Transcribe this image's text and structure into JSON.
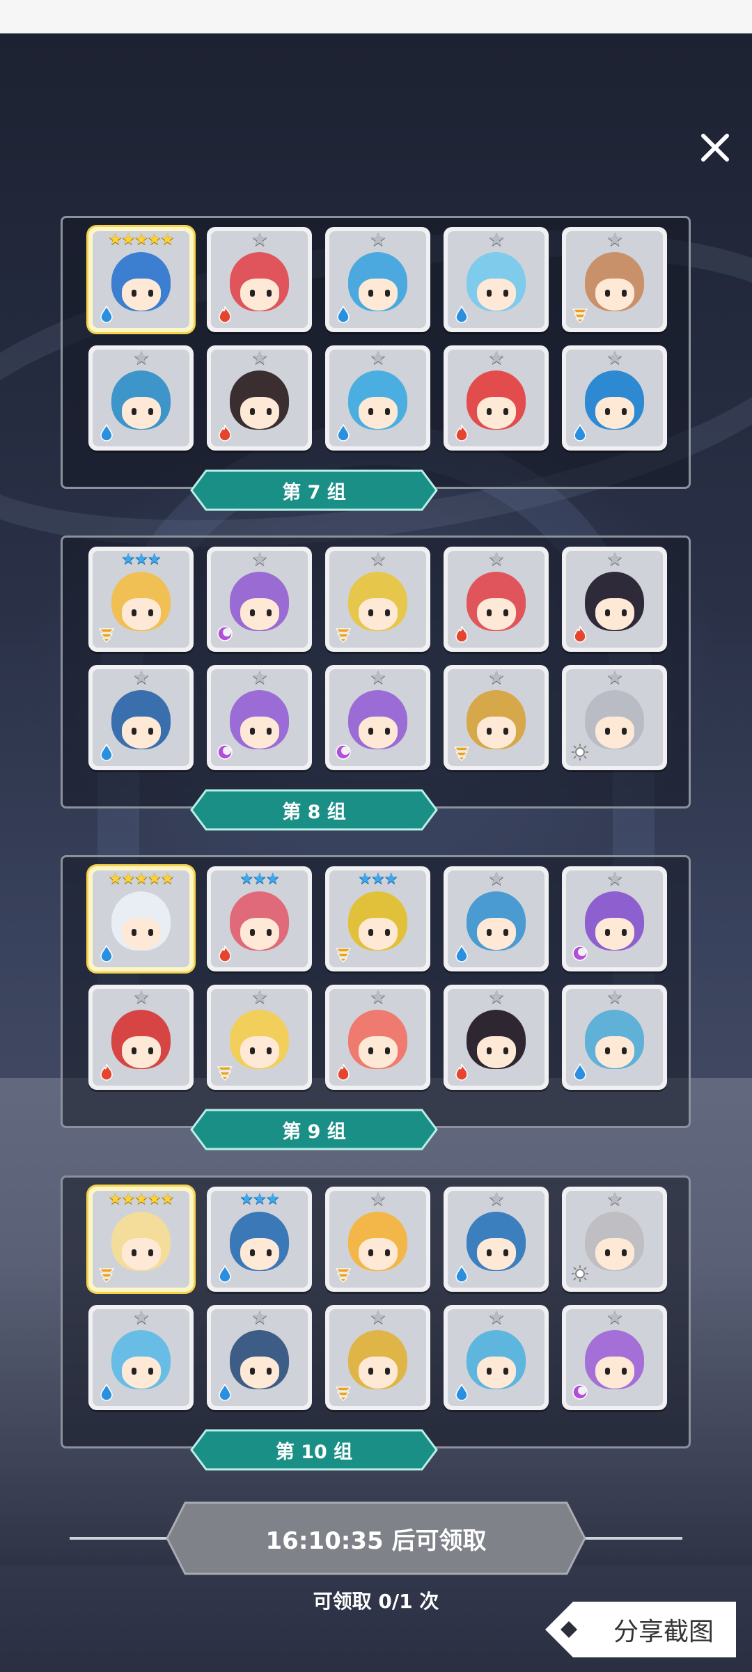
{
  "status_bar": {},
  "close_icon": "close-icon",
  "groups": [
    {
      "label": "第 7 组",
      "cards": [
        {
          "rarity": "gold",
          "stars": "★★★★★",
          "element": "water",
          "hair": "#3c7fd1"
        },
        {
          "rarity": "gray",
          "stars": "★",
          "element": "fire",
          "hair": "#e0555b"
        },
        {
          "rarity": "gray",
          "stars": "★",
          "element": "water",
          "hair": "#4ba9df"
        },
        {
          "rarity": "gray",
          "stars": "★",
          "element": "water",
          "hair": "#7ecbec"
        },
        {
          "rarity": "gray",
          "stars": "★",
          "element": "earth",
          "hair": "#c9916a"
        },
        {
          "rarity": "gray",
          "stars": "★",
          "element": "water",
          "hair": "#3e95c9"
        },
        {
          "rarity": "gray",
          "stars": "★",
          "element": "fire",
          "hair": "#3a2e30"
        },
        {
          "rarity": "gray",
          "stars": "★",
          "element": "water",
          "hair": "#4aaee0"
        },
        {
          "rarity": "gray",
          "stars": "★",
          "element": "fire",
          "hair": "#e34c4c"
        },
        {
          "rarity": "gray",
          "stars": "★",
          "element": "water",
          "hair": "#2d8ad2"
        }
      ]
    },
    {
      "label": "第 8 组",
      "cards": [
        {
          "rarity": "blue",
          "stars": "★★★",
          "element": "earth",
          "hair": "#f0c055"
        },
        {
          "rarity": "gray",
          "stars": "★",
          "element": "dark",
          "hair": "#9a6bd2"
        },
        {
          "rarity": "gray",
          "stars": "★",
          "element": "earth",
          "hair": "#e6c74b"
        },
        {
          "rarity": "gray",
          "stars": "★",
          "element": "fire",
          "hair": "#e0555b"
        },
        {
          "rarity": "gray",
          "stars": "★",
          "element": "fire",
          "hair": "#2f2a3a"
        },
        {
          "rarity": "gray",
          "stars": "★",
          "element": "water",
          "hair": "#3a6fae"
        },
        {
          "rarity": "gray",
          "stars": "★",
          "element": "dark",
          "hair": "#9b6cd6"
        },
        {
          "rarity": "gray",
          "stars": "★",
          "element": "dark",
          "hair": "#9b6cd6"
        },
        {
          "rarity": "gray",
          "stars": "★",
          "element": "earth",
          "hair": "#d6a84a"
        },
        {
          "rarity": "gray",
          "stars": "★",
          "element": "light",
          "hair": "#b9bcc5"
        }
      ]
    },
    {
      "label": "第 9 组",
      "cards": [
        {
          "rarity": "gold",
          "stars": "★★★★★",
          "element": "water",
          "hair": "#e8eef4"
        },
        {
          "rarity": "blue",
          "stars": "★★★",
          "element": "fire",
          "hair": "#e06a7a"
        },
        {
          "rarity": "blue",
          "stars": "★★★",
          "element": "earth",
          "hair": "#e2c13a"
        },
        {
          "rarity": "gray",
          "stars": "★",
          "element": "water",
          "hair": "#4a9bd1"
        },
        {
          "rarity": "gray",
          "stars": "★",
          "element": "dark",
          "hair": "#8d5fcf"
        },
        {
          "rarity": "gray",
          "stars": "★",
          "element": "fire",
          "hair": "#d64444"
        },
        {
          "rarity": "gray",
          "stars": "★",
          "element": "earth",
          "hair": "#f2cf5a"
        },
        {
          "rarity": "gray",
          "stars": "★",
          "element": "fire",
          "hair": "#ef7a6f"
        },
        {
          "rarity": "gray",
          "stars": "★",
          "element": "fire",
          "hair": "#2e2630"
        },
        {
          "rarity": "gray",
          "stars": "★",
          "element": "water",
          "hair": "#5fb1d8"
        }
      ]
    },
    {
      "label": "第 10 组",
      "cards": [
        {
          "rarity": "gold",
          "stars": "★★★★★",
          "element": "earth",
          "hair": "#f4dd9a"
        },
        {
          "rarity": "blue",
          "stars": "★★★",
          "element": "water",
          "hair": "#3b78b8"
        },
        {
          "rarity": "gray",
          "stars": "★",
          "element": "earth",
          "hair": "#f3b648"
        },
        {
          "rarity": "gray",
          "stars": "★",
          "element": "water",
          "hair": "#3b7fbf"
        },
        {
          "rarity": "gray",
          "stars": "★",
          "element": "light",
          "hair": "#bfbfc3"
        },
        {
          "rarity": "gray",
          "stars": "★",
          "element": "water",
          "hair": "#67bde6"
        },
        {
          "rarity": "gray",
          "stars": "★",
          "element": "water",
          "hair": "#3e5d86"
        },
        {
          "rarity": "gray",
          "stars": "★",
          "element": "earth",
          "hair": "#e0b548"
        },
        {
          "rarity": "gray",
          "stars": "★",
          "element": "water",
          "hair": "#5eb5dd"
        },
        {
          "rarity": "gray",
          "stars": "★",
          "element": "dark",
          "hair": "#a470d8"
        }
      ]
    }
  ],
  "claim": {
    "button_label": "16:10:35 后可领取",
    "count_label": "可领取 0/1 次"
  },
  "share": {
    "label": "分享截图"
  },
  "colors": {
    "ribbon": "#1a8f86",
    "ribbon_border": "#b8f0e8",
    "claim_button": "#7f8288",
    "panel_border": "#8d919c"
  }
}
